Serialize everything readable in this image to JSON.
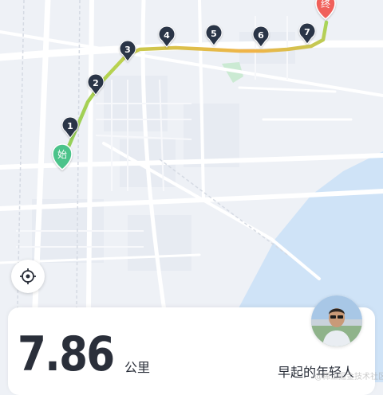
{
  "map": {
    "start_marker": {
      "label": "始",
      "color": "#4cc38a"
    },
    "end_marker": {
      "label": "终",
      "color": "#f0605a"
    },
    "km_markers": [
      "1",
      "2",
      "3",
      "4",
      "5",
      "6",
      "7"
    ],
    "route_colors": {
      "start": "#8fcf5a",
      "mid": "#d6d84e",
      "end": "#f2b347"
    },
    "water_color": "#cfe3f7",
    "marker_color": "#2b3447",
    "locate_icon": "crosshair-icon"
  },
  "summary": {
    "distance_value": "7.86",
    "distance_unit": "公里",
    "username": "早起的年轻人",
    "avatar_icon": "user-avatar-icon"
  },
  "watermark": "@稀土掘金技术社区"
}
